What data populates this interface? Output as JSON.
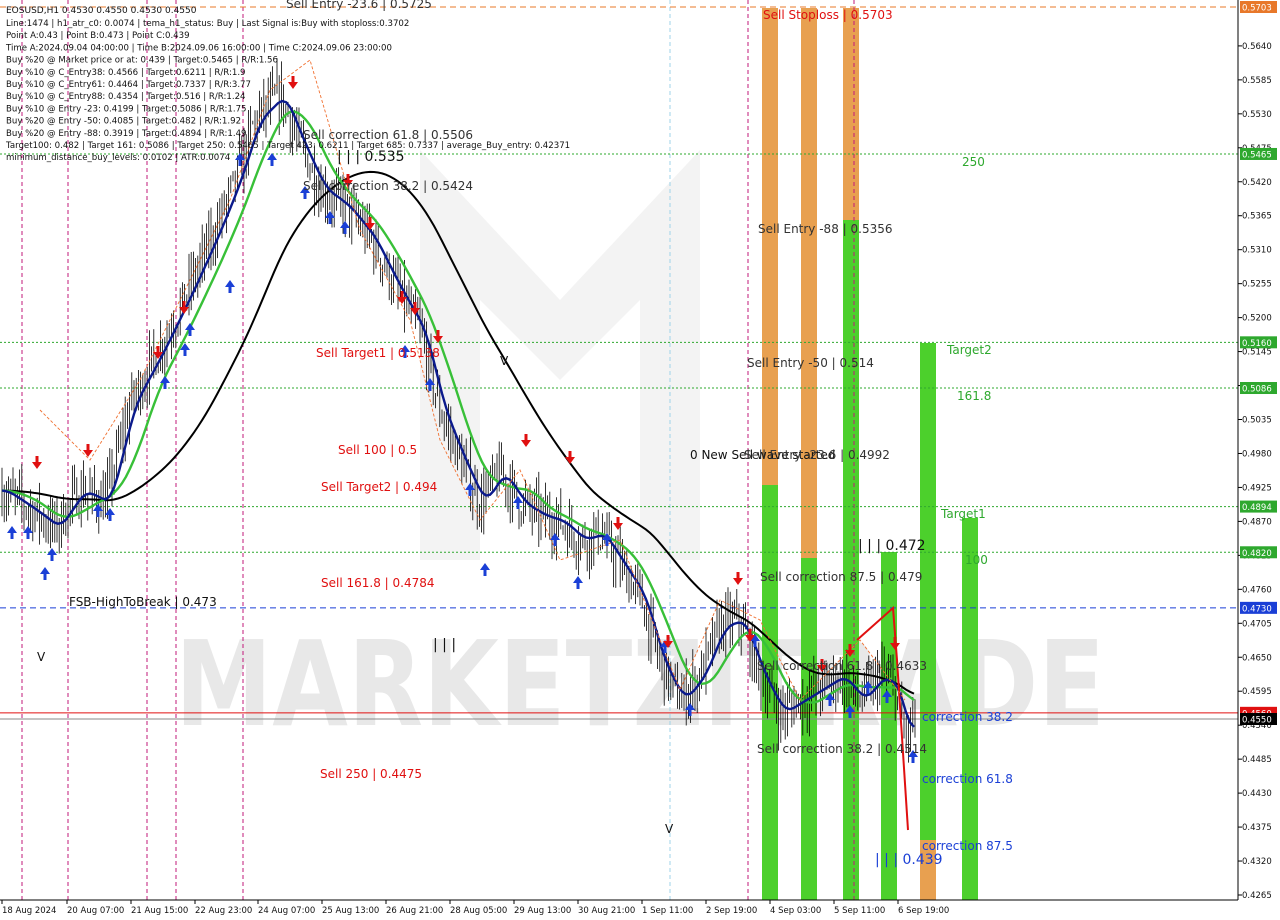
{
  "chart_data": {
    "type": "candlestick",
    "symbol_header": "EOSUSD,H1  0.4530 0.4550 0.4530 0.4550",
    "info_lines": [
      "Line:1474 | h1_atr_c0: 0.0074 | tema_h1_status: Buy | Last Signal is:Buy with stoploss:0.3702",
      "Point A:0.43 | Point B:0.473 | Point C:0.439",
      "Time A:2024.09.04 04:00:00 | Time B:2024.09.06 16:00:00 | Time C:2024.09.06 23:00:00",
      "Buy %20 @ Market price or at: 0.439 | Target:0.5465 | R/R:1.56",
      "Buy %10 @ C_Entry38: 0.4566 | Target:0.6211 | R/R:1.9",
      "Buy %10 @ C_Entry61: 0.4464 | Target:0.7337 | R/R:3.77",
      "Buy %10 @ C_Entry88: 0.4354 | Target:0.516 | R/R:1.24",
      "Buy %10 @ Entry -23: 0.4199 | Target:0.5086 | R/R:1.75",
      "Buy %20 @ Entry -50: 0.4085 | Target:0.482 | R/R:1.92",
      "Buy %20 @ Entry -88: 0.3919 | Target:0.4894 | R/R:1.49",
      "Target100: 0.482 | Target 161: 0.5086 | Target 250: 0.5465 | Target 423: 0.6211 | Target 685: 0.7337 | average_Buy_entry: 0.42371",
      "minimum_distance_buy_levels: 0.0102 | ATR:0.0074"
    ],
    "y_range": [
      0.4265,
      0.5703
    ],
    "y_ticks": [
      0.564,
      0.5585,
      0.553,
      0.5475,
      0.542,
      0.5365,
      0.531,
      0.5255,
      0.52,
      0.5145,
      0.509,
      0.5035,
      0.498,
      0.4925,
      0.487,
      0.4815,
      0.476,
      0.4705,
      0.465,
      0.4595,
      0.454,
      0.4485,
      0.443,
      0.4375,
      0.432,
      0.4265
    ],
    "x_labels": [
      "18 Aug 2024",
      "20 Aug 07:00",
      "21 Aug 15:00",
      "22 Aug 23:00",
      "24 Aug 07:00",
      "25 Aug 13:00",
      "26 Aug 21:00",
      "28 Aug 05:00",
      "29 Aug 13:00",
      "30 Aug 21:00",
      "1 Sep 11:00",
      "2 Sep 19:00",
      "4 Sep 03:00",
      "5 Sep 11:00",
      "6 Sep 19:00"
    ],
    "price_tags": [
      {
        "value": 0.5703,
        "label": "0.5703",
        "color": "#e8782a"
      },
      {
        "value": 0.5465,
        "label": "0.5465",
        "color": "#2ea82e"
      },
      {
        "value": 0.516,
        "label": "0.5160",
        "color": "#2ea82e"
      },
      {
        "value": 0.5086,
        "label": "0.5086",
        "color": "#2ea82e"
      },
      {
        "value": 0.4894,
        "label": "0.4894",
        "color": "#2ea82e"
      },
      {
        "value": 0.482,
        "label": "0.4820",
        "color": "#2ea82e"
      },
      {
        "value": 0.473,
        "label": "0.4730",
        "color": "#1a3fd6"
      },
      {
        "value": 0.456,
        "label": "0.4560",
        "color": "#e01010"
      },
      {
        "value": 0.455,
        "label": "0.4550",
        "color": "#000000"
      }
    ],
    "level_lines": [
      {
        "value": 0.5703,
        "color": "#e8782a",
        "style": "dash"
      },
      {
        "value": 0.5465,
        "color": "#2ea82e",
        "style": "dot"
      },
      {
        "value": 0.516,
        "color": "#2ea82e",
        "style": "dot"
      },
      {
        "value": 0.5086,
        "color": "#2ea82e",
        "style": "dot"
      },
      {
        "value": 0.4894,
        "color": "#2ea82e",
        "style": "dot"
      },
      {
        "value": 0.482,
        "color": "#2ea82e",
        "style": "dot"
      },
      {
        "value": 0.473,
        "color": "#1a3fd6",
        "style": "dash"
      },
      {
        "value": 0.456,
        "color": "#e01010",
        "style": "solid"
      },
      {
        "value": 0.455,
        "color": "#888888",
        "style": "solid"
      }
    ],
    "annotations": [
      {
        "text": "Sell Entry -23.6 | 0.5725",
        "x": 0.0,
        "y": 0.5725,
        "color": "#333333"
      },
      {
        "text": "Sell Stoploss | 0.5703",
        "x": 0.0,
        "y": 0.5703,
        "color": "#e01010"
      },
      {
        "text": "Sell correction 61.8 | 0.5506",
        "x": 0.0,
        "y": 0.5506,
        "color": "#333333"
      },
      {
        "text": "| | | 0.535",
        "x": 0.0,
        "y": 0.535,
        "color": "#111111"
      },
      {
        "text": "Sell correction 38.2 | 0.5424",
        "x": 0.0,
        "y": 0.5424,
        "color": "#333333"
      },
      {
        "text": "Sell Entry -88 | 0.5356",
        "x": 0.0,
        "y": 0.5356,
        "color": "#333333"
      },
      {
        "text": "250",
        "x": 0.0,
        "y": 0.5465,
        "color": "#2ea82e"
      },
      {
        "text": "Sell Target1 | 0.5138",
        "x": 0.0,
        "y": 0.5138,
        "color": "#e01010"
      },
      {
        "text": "Sell Entry -50 | 0.514",
        "x": 0.0,
        "y": 0.514,
        "color": "#333333"
      },
      {
        "text": "Target2",
        "x": 0.0,
        "y": 0.516,
        "color": "#2ea82e"
      },
      {
        "text": "161.8",
        "x": 0.0,
        "y": 0.5086,
        "color": "#2ea82e"
      },
      {
        "text": "Sell 100 | 0.5",
        "x": 0.0,
        "y": 0.5,
        "color": "#e01010"
      },
      {
        "text": "0 New Sell wave started",
        "x": 0.0,
        "y": 0.4992,
        "color": "#111111"
      },
      {
        "text": "Sell Entry -23.6 | 0.4992",
        "x": 0.0,
        "y": 0.4992,
        "color": "#333333"
      },
      {
        "text": "Sell Target2 | 0.494",
        "x": 0.0,
        "y": 0.494,
        "color": "#e01010"
      },
      {
        "text": "Target1",
        "x": 0.0,
        "y": 0.4894,
        "color": "#2ea82e"
      },
      {
        "text": "| | | 0.472",
        "x": 0.0,
        "y": 0.4832,
        "color": "#111111"
      },
      {
        "text": "100",
        "x": 0.0,
        "y": 0.482,
        "color": "#2ea82e"
      },
      {
        "text": "Sell 161.8 | 0.4784",
        "x": 0.0,
        "y": 0.4784,
        "color": "#e01010"
      },
      {
        "text": "Sell correction 87.5 | 0.479",
        "x": 0.0,
        "y": 0.479,
        "color": "#333333"
      },
      {
        "text": "FSB-HighToBreak | 0.473",
        "x": 0.0,
        "y": 0.473,
        "color": "#111111"
      },
      {
        "text": "| | |",
        "x": 0.0,
        "y": 0.4665,
        "color": "#111111"
      },
      {
        "text": "V",
        "x": 0.0,
        "y": 0.4642,
        "color": "#111111"
      },
      {
        "text": "Sell correction 61.8 | 0.4633",
        "x": 0.0,
        "y": 0.4633,
        "color": "#333333"
      },
      {
        "text": "correction 38.2",
        "x": 0.0,
        "y": 0.4552,
        "color": "#1a3fd6"
      },
      {
        "text": "Sell correction 38.2 | 0.4514",
        "x": 0.0,
        "y": 0.4514,
        "color": "#333333"
      },
      {
        "text": "Sell 250 | 0.4475",
        "x": 0.0,
        "y": 0.4475,
        "color": "#e01010"
      },
      {
        "text": "correction 61.8",
        "x": 0.0,
        "y": 0.4465,
        "color": "#1a3fd6"
      },
      {
        "text": "V",
        "x": 0.0,
        "y": 0.4385,
        "color": "#111111"
      },
      {
        "text": "correction 87.5",
        "x": 0.0,
        "y": 0.4352,
        "color": "#1a3fd6"
      },
      {
        "text": "| | | 0.439",
        "x": 0.0,
        "y": 0.4329,
        "color": "#1a3fd6"
      },
      {
        "text": "V",
        "x": 0.0,
        "y": 0.5135,
        "color": "#111111"
      }
    ],
    "watermark": "MARKETZITRADE",
    "colors": {
      "candle": "#000000",
      "ema_fast": "#0b1a8c",
      "ema_mid": "#38c038",
      "ema_slow": "#000000",
      "sell_zone": "#e8a050",
      "buy_zone": "#4cd02c",
      "grid": "#e5e5e5",
      "buy_arrow": "#1a3fd6",
      "sell_arrow": "#e01010"
    }
  }
}
